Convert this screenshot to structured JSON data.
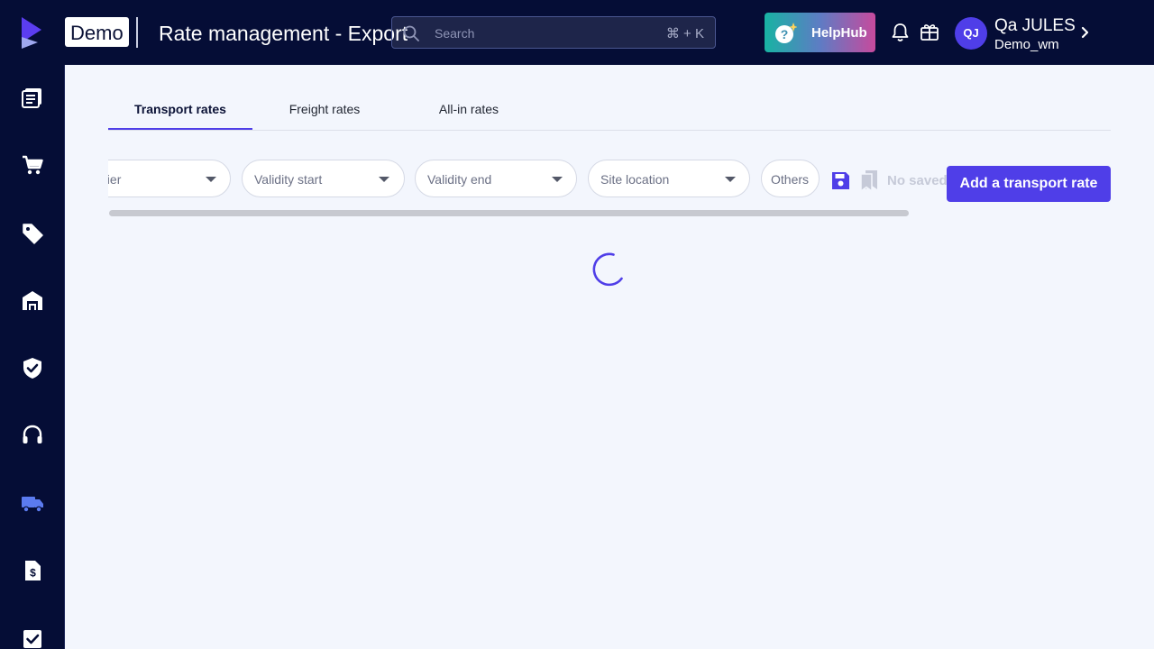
{
  "header": {
    "brand_badge": "Demo",
    "title": "Rate management - Export",
    "search": {
      "placeholder": "Search",
      "shortcut": "⌘ + K"
    },
    "helphub_label": "HelpHub",
    "user": {
      "initials": "QJ",
      "name": "Qa JULES",
      "org": "Demo_wm"
    }
  },
  "sidebar": {
    "items": [
      {
        "icon": "catalog-icon"
      },
      {
        "icon": "cart-icon"
      },
      {
        "icon": "tag-icon"
      },
      {
        "icon": "warehouse-icon"
      },
      {
        "icon": "shield-check-icon"
      },
      {
        "icon": "headset-icon"
      },
      {
        "icon": "truck-icon",
        "active": true
      },
      {
        "icon": "invoice-icon"
      },
      {
        "icon": "checkbox-icon"
      }
    ]
  },
  "tabs": [
    {
      "label": "Transport rates",
      "active": true
    },
    {
      "label": "Freight rates"
    },
    {
      "label": "All-in rates"
    }
  ],
  "filters": {
    "supplier": "Supplier",
    "validity_start": "Validity start",
    "validity_end": "Validity end",
    "site_location": "Site location",
    "others": "Others",
    "no_saved": "No saved"
  },
  "actions": {
    "add_transport_rate": "Add a transport rate"
  },
  "colors": {
    "topbar_bg": "#050d36",
    "accent": "#4f3ee8",
    "page_bg": "#f3f6fd",
    "active_nav_icon": "#5b7bf0"
  }
}
